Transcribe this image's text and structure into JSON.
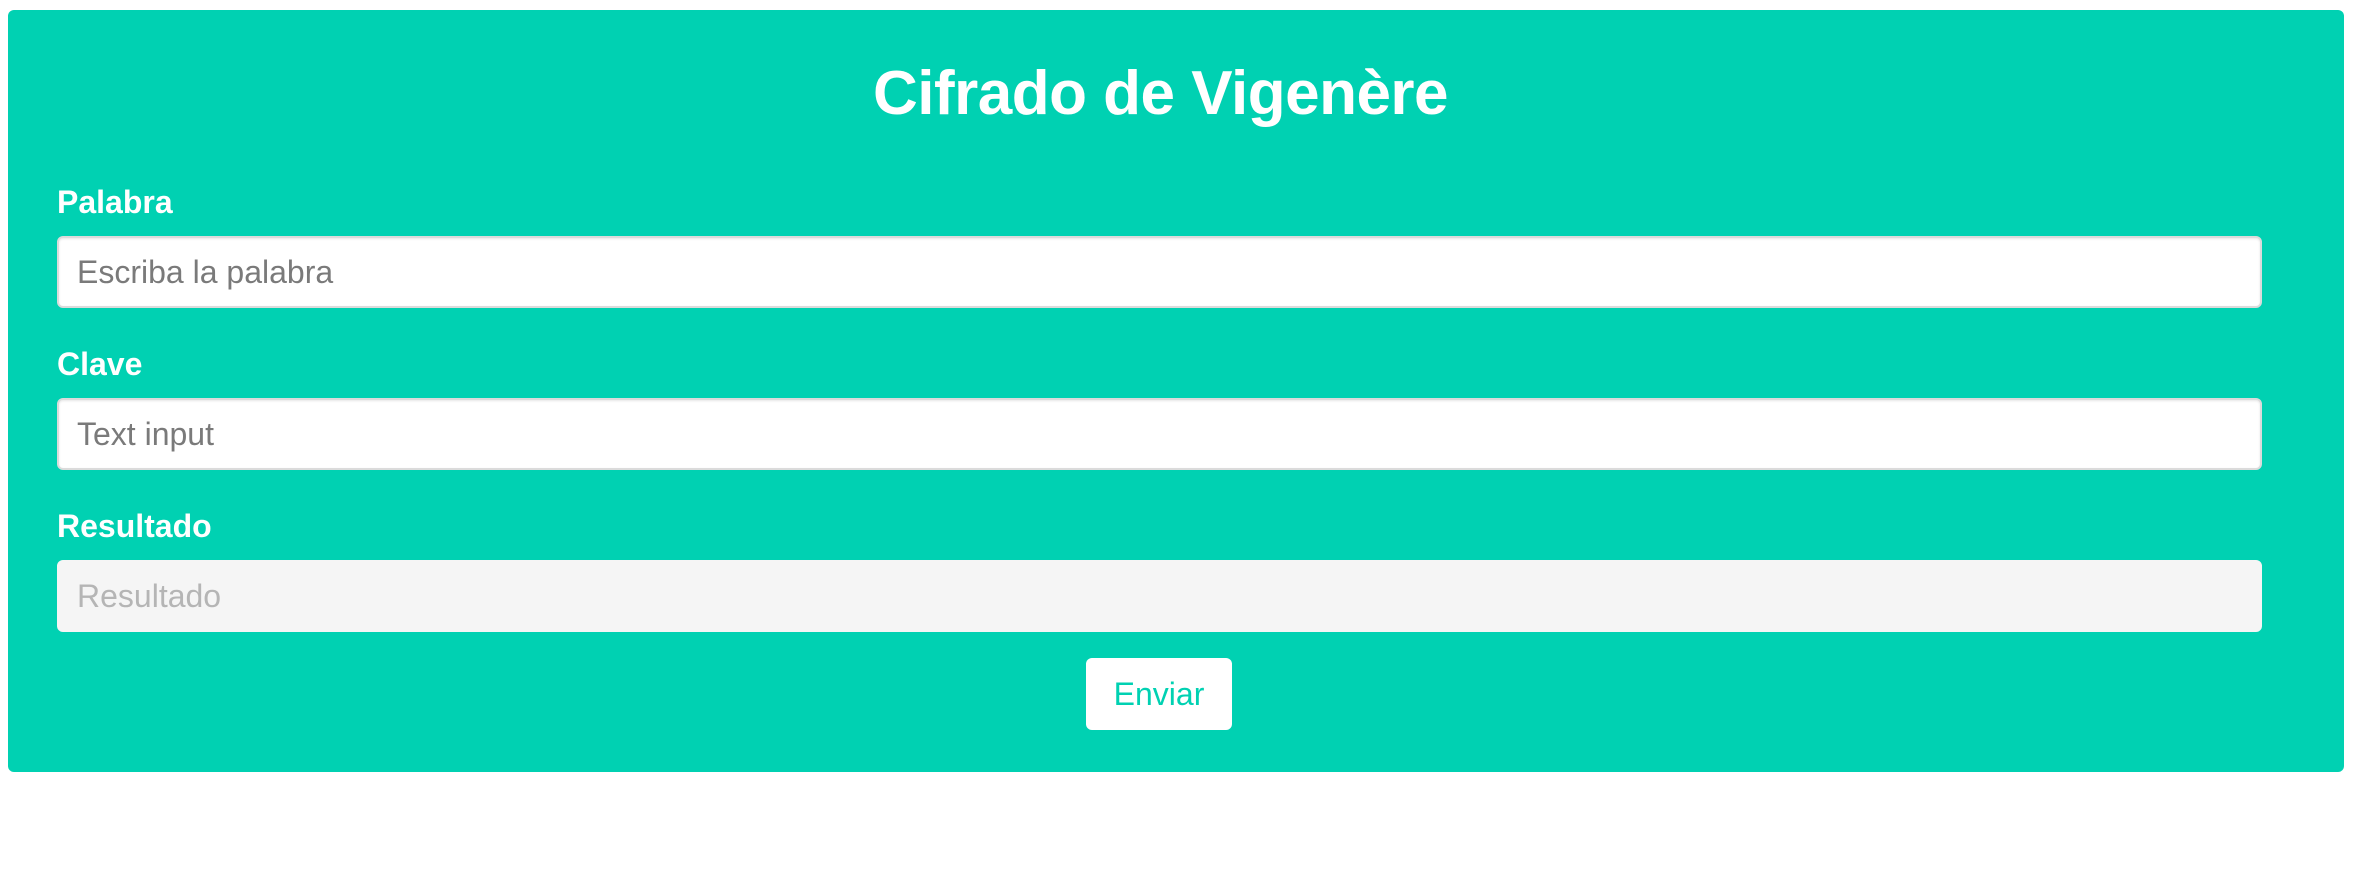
{
  "page": {
    "title": "Cifrado de Vigenère"
  },
  "form": {
    "palabra": {
      "label": "Palabra",
      "placeholder": "Escriba la palabra",
      "value": ""
    },
    "clave": {
      "label": "Clave",
      "placeholder": "Text input",
      "value": ""
    },
    "resultado": {
      "label": "Resultado",
      "placeholder": "Resultado",
      "value": ""
    },
    "submit_label": "Enviar"
  },
  "colors": {
    "accent": "#00d1b2",
    "text_on_accent": "#ffffff",
    "disabled_field": "#f5f5f5"
  }
}
